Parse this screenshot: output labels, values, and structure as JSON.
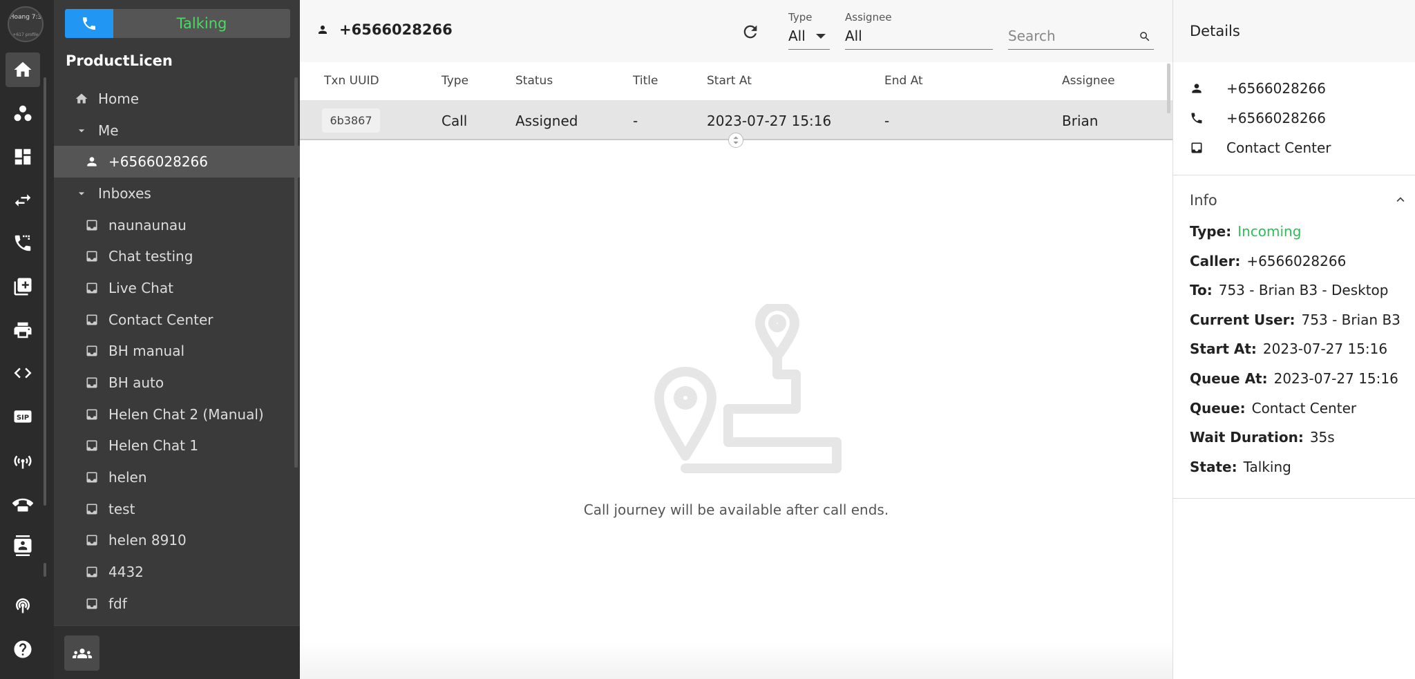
{
  "user": {
    "avatar_line1": "Hoang",
    "avatar_line2": "7:3",
    "avatar_sub": "+617 profile"
  },
  "call_widget": {
    "status": "Talking"
  },
  "nav": {
    "title": "ProductLicen",
    "items": [
      {
        "label": "Home"
      },
      {
        "label": "Me"
      },
      {
        "label": "+6566028266"
      },
      {
        "label": "Inboxes"
      }
    ],
    "inboxes": [
      "naunaunau",
      "Chat testing",
      "Live Chat",
      "Contact Center",
      "BH manual",
      "BH auto",
      "Helen Chat 2 (Manual)",
      "Helen Chat 1",
      "helen",
      "test",
      "helen 8910",
      "4432",
      "fdf"
    ]
  },
  "header": {
    "title": "+6566028266",
    "type_label": "Type",
    "type_value": "All",
    "assignee_label": "Assignee",
    "assignee_value": "All",
    "search_placeholder": "Search"
  },
  "table": {
    "columns": [
      "Txn UUID",
      "Type",
      "Status",
      "Title",
      "Start At",
      "End At",
      "Assignee"
    ],
    "rows": [
      {
        "uuid": "6b3867",
        "type": "Call",
        "status": "Assigned",
        "title": "-",
        "start_at": "2023-07-27 15:16",
        "end_at": "-",
        "assignee": "Brian"
      }
    ]
  },
  "empty_state": {
    "message": "Call journey will be available after call ends."
  },
  "details": {
    "title": "Details",
    "contact": [
      "+6566028266",
      "+6566028266",
      "Contact Center"
    ],
    "info_title": "Info",
    "info": [
      {
        "key": "Type:",
        "value": "Incoming"
      },
      {
        "key": "Caller:",
        "value": "+6566028266"
      },
      {
        "key": "To:",
        "value": "753 - Brian B3  - Desktop"
      },
      {
        "key": "Current User:",
        "value": "753 - Brian B3"
      },
      {
        "key": "Start At:",
        "value": "2023-07-27 15:16"
      },
      {
        "key": "Queue At:",
        "value": "2023-07-27 15:16"
      },
      {
        "key": "Queue:",
        "value": "Contact Center"
      },
      {
        "key": "Wait Duration:",
        "value": "35s"
      },
      {
        "key": "State:",
        "value": "Talking"
      }
    ]
  },
  "colors": {
    "accent": "#2196f3",
    "talking": "#4cd964",
    "incoming": "#2ebd59",
    "sidebar": "#3a3a3a",
    "rail": "#2b2b2b"
  },
  "icons": [
    "home-icon",
    "contacts-icon",
    "dashboard-icon",
    "transfer-icon",
    "call-log-icon",
    "reports-icon",
    "print-icon",
    "code-icon",
    "sip-icon",
    "broadcast-icon",
    "telephone-icon",
    "contact-card-icon",
    "signal-icon",
    "help-icon"
  ]
}
